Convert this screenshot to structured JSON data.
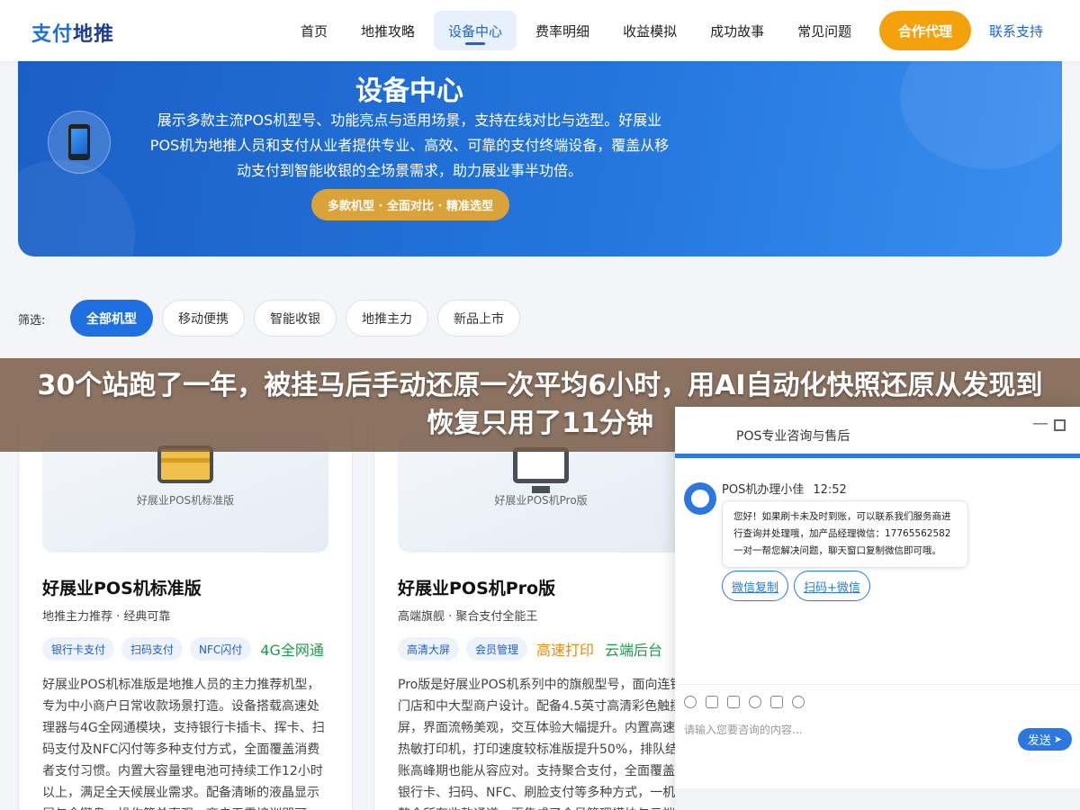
{
  "header": {
    "logo_part1": "支付",
    "logo_part2": "地推",
    "nav": [
      "首页",
      "地推攻略",
      "设备中心",
      "费率明细",
      "收益模拟",
      "成功故事",
      "常见问题"
    ],
    "active_nav": "设备中心",
    "agent_button": "合作代理",
    "contact_link": "联系支持"
  },
  "banner": {
    "title": "设备中心",
    "description": "展示多款主流POS机型号、功能亮点与适用场景，支持在线对比与选型。好展业POS机为地推人员和支付从业者提供专业、高效、可靠的支付终端设备，覆盖从移动支付到智能收银的全场景需求，助力展业事半功倍。",
    "pill": "多款机型 · 全面对比 · 精准选型"
  },
  "filter": {
    "label": "筛选:",
    "options": [
      "全部机型",
      "移动便携",
      "智能收银",
      "地推主力",
      "新品上市"
    ],
    "active": "全部机型"
  },
  "overlay_caption": "30个站跑了一年，被挂马后手动还原一次平均6小时，用AI自动化快照还原从发现到恢复只用了11分钟",
  "products": [
    {
      "image_label": "好展业POS机标准版",
      "title": "好展业POS机标准版",
      "subtitle": "地推主力推荐 · 经典可靠",
      "tags": [
        "银行卡支付",
        "扫码支付",
        "NFC闪付"
      ],
      "highlight_tags": [
        "4G全网通"
      ],
      "description": "好展业POS机标准版是地推人员的主力推荐机型，专为中小商户日常收款场景打造。设备搭载高速处理器与4G全网通模块，支持银行卡插卡、挥卡、扫码支付及NFC闪付等多种支付方式，全面覆盖消费者支付习惯。内置大容量锂电池可持续工作12小时以上，满足全天候展业需求。配备清晰的液晶显示屏与全键盘，操作简单直观，商户无需培训即可"
    },
    {
      "image_label": "好展业POS机Pro版",
      "title": "好展业POS机Pro版",
      "subtitle": "高端旗舰 · 聚合支付全能王",
      "tags": [
        "高清大屏",
        "会员管理"
      ],
      "highlight_tags": [
        "高速打印",
        "云端后台"
      ],
      "description": "Pro版是好展业POS机系列中的旗舰型号，面向连锁门店和中大型商户设计。配备4.5英寸高清彩色触摸屏，界面流畅美观，交互体验大幅提升。内置高速热敏打印机，打印速度较标准版提升50%，排队结账高峰期也能从容应对。支持聚合支付，全面覆盖银行卡、扫码、NFC、刷脸支付等多种方式，一机整合所有收款通道，更集成了会员管理模块与云端"
    }
  ],
  "chat": {
    "header_title": "POS专业咨询与售后",
    "agent_name": "POS机办理小佳",
    "time": "12:52",
    "message": "您好！如果刷卡未及时到账，可以联系我们服务商进行查询并处理哦，加产品经理微信：17765562582 一对一帮您解决问题，聊天窗口复制微信即可哦。",
    "actions": [
      "微信复制",
      "扫码+微信"
    ],
    "input_placeholder": "请输入您要咨询的内容...",
    "send_label": "发送"
  },
  "colors": {
    "primary": "#1e6fe0",
    "accent_orange": "#f4a20c",
    "banner_blue": "#2375dc",
    "pill_gold": "#d9a33a",
    "caption_overlay": "#785a46"
  }
}
